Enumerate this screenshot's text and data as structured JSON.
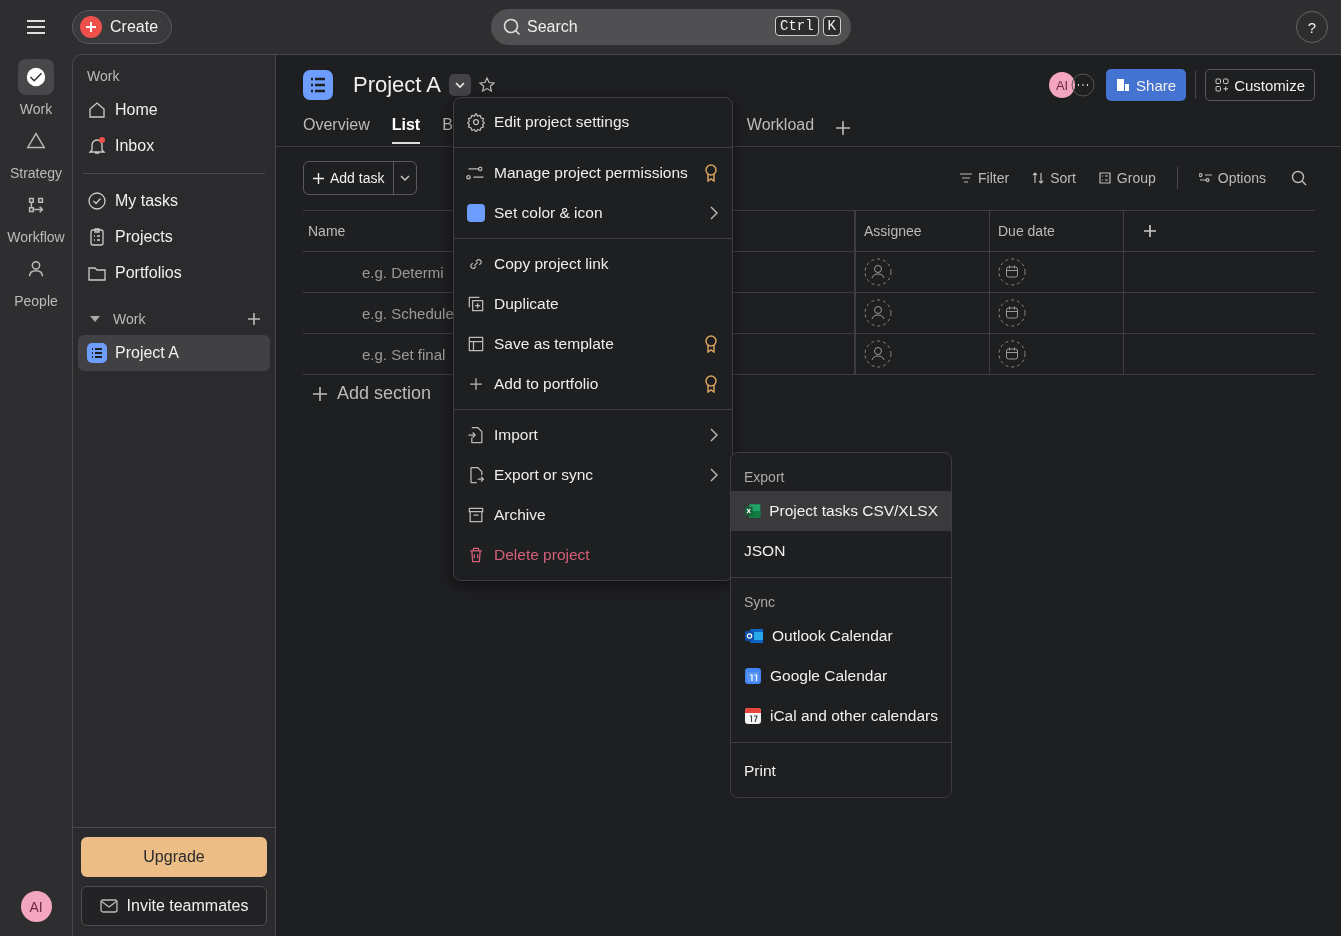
{
  "topbar": {
    "create": "Create",
    "search": {
      "placeholder": "Search",
      "keys": [
        "Ctrl",
        "K"
      ]
    },
    "help": "?"
  },
  "rail": {
    "items": [
      {
        "label": "Work",
        "selected": true
      },
      {
        "label": "Strategy",
        "selected": false
      },
      {
        "label": "Workflow",
        "selected": false
      },
      {
        "label": "People",
        "selected": false
      }
    ],
    "avatar": "AI"
  },
  "sidebar": {
    "heading": "Work",
    "nav": [
      {
        "label": "Home",
        "unread": false
      },
      {
        "label": "Inbox",
        "unread": true
      }
    ],
    "nav2": [
      {
        "label": "My tasks"
      },
      {
        "label": "Projects"
      },
      {
        "label": "Portfolios"
      }
    ],
    "section": {
      "label": "Work",
      "expanded": true,
      "projects": [
        {
          "label": "Project A",
          "selected": true
        }
      ]
    },
    "upgrade": "Upgrade",
    "invite": "Invite teammates"
  },
  "project": {
    "title": "Project A",
    "starred": false,
    "avatar": "AI",
    "share": "Share",
    "customize": "Customize",
    "tabs": [
      {
        "label": "Overview",
        "selected": false
      },
      {
        "label": "List",
        "selected": true
      },
      {
        "label": "B",
        "selected": false
      },
      {
        "label": "Workload",
        "selected": false
      }
    ],
    "add_task": "Add task",
    "tools": [
      "Filter",
      "Sort",
      "Group",
      "Options"
    ]
  },
  "table": {
    "columns": [
      "Name",
      "Assignee",
      "Due date"
    ],
    "rows": [
      {
        "name": "e.g. Determi"
      },
      {
        "name": "e.g. Schedule"
      },
      {
        "name": "e.g. Set final"
      }
    ],
    "add_section": "Add section"
  },
  "menu": {
    "groups": [
      [
        {
          "label": "Edit project settings",
          "kind": "normal",
          "premium": false,
          "submenu": false
        }
      ],
      [
        {
          "label": "Manage project permissions",
          "kind": "normal",
          "premium": true,
          "submenu": false
        },
        {
          "label": "Set color & icon",
          "kind": "color",
          "color": "#6d9eff",
          "premium": false,
          "submenu": true
        }
      ],
      [
        {
          "label": "Copy project link",
          "kind": "normal",
          "premium": false,
          "submenu": false
        },
        {
          "label": "Duplicate",
          "kind": "normal",
          "premium": false,
          "submenu": false
        },
        {
          "label": "Save as template",
          "kind": "normal",
          "premium": true,
          "submenu": false
        },
        {
          "label": "Add to portfolio",
          "kind": "normal",
          "premium": true,
          "submenu": false
        }
      ],
      [
        {
          "label": "Import",
          "kind": "normal",
          "premium": false,
          "submenu": true
        },
        {
          "label": "Export or sync",
          "kind": "normal",
          "premium": false,
          "submenu": true
        },
        {
          "label": "Archive",
          "kind": "normal",
          "premium": false,
          "submenu": false
        },
        {
          "label": "Delete project",
          "kind": "danger",
          "premium": false,
          "submenu": false
        }
      ]
    ]
  },
  "submenu": {
    "sections": [
      {
        "heading": "Export",
        "items": [
          {
            "label": "Project tasks CSV/XLSX",
            "selected": true
          },
          {
            "label": "JSON",
            "selected": false
          }
        ]
      },
      {
        "heading": "Sync",
        "items": [
          {
            "label": "Outlook Calendar",
            "selected": false
          },
          {
            "label": "Google Calendar",
            "selected": false
          },
          {
            "label": "iCal and other calendars",
            "selected": false
          }
        ]
      },
      {
        "items": [
          {
            "label": "Print",
            "selected": false
          }
        ]
      }
    ]
  }
}
